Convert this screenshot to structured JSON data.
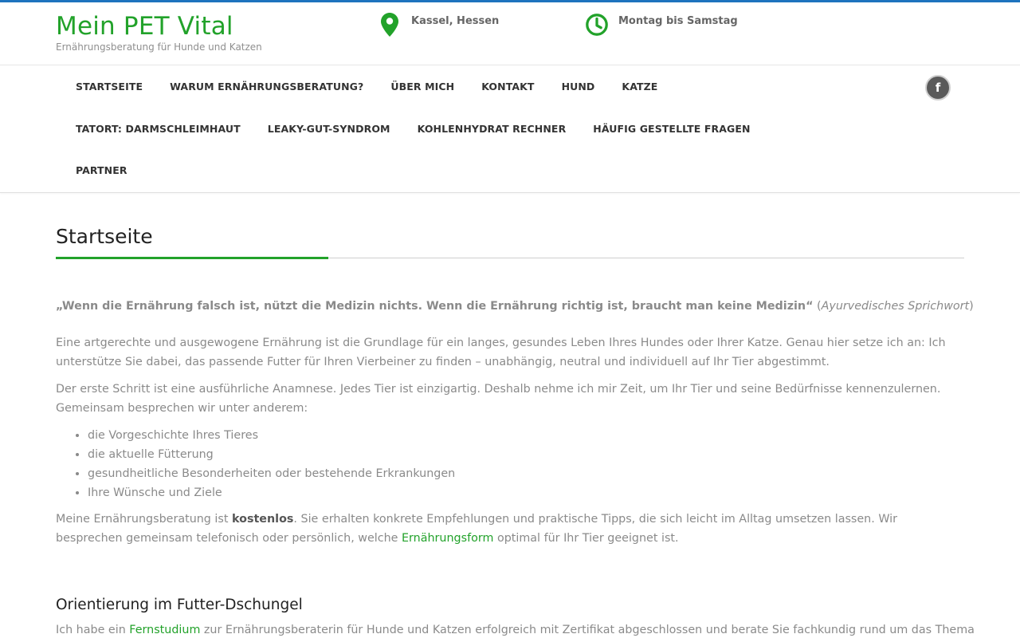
{
  "colors": {
    "accent": "#22a22a",
    "top_line": "#1e73be",
    "text": "#8a8a8a",
    "heading": "#222222"
  },
  "header": {
    "site_title": "Mein PET Vital",
    "site_description": "Ernährungsberatung für Hunde und Katzen",
    "location": {
      "icon": "map-marker-icon",
      "text": "Kassel, Hessen"
    },
    "hours": {
      "icon": "clock-icon",
      "text": "Montag bis Samstag"
    }
  },
  "nav": {
    "row1": [
      "STARTSEITE",
      "WARUM ERNÄHRUNGSBERATUNG?",
      "ÜBER MICH",
      "KONTAKT",
      "HUND",
      "KATZE"
    ],
    "row2": [
      "TATORT: DARMSCHLEIMHAUT",
      "LEAKY-GUT-SYNDROM",
      "KOHLENHYDRAT RECHNER",
      "HÄUFIG GESTELLTE FRAGEN"
    ],
    "row3": [
      "PARTNER"
    ],
    "social": {
      "icon": "facebook-icon",
      "glyph": "f"
    }
  },
  "content": {
    "page_title": "Startseite",
    "quote": {
      "text": "„Wenn die Ernährung falsch ist, nützt die Medizin nichts. Wenn die Ernährung richtig ist, braucht man keine Medizin“",
      "open_paren": " (",
      "source": "Ayurvedisches Sprichwort",
      "close_paren": ")"
    },
    "paragraph1": "Eine artgerechte und ausgewogene Ernährung ist die Grundlage für ein langes, gesundes Leben Ihres Hundes oder Ihrer Katze. Genau hier setze ich an: Ich unterstütze Sie dabei, das passende Futter für Ihren Vierbeiner zu finden – unabhängig, neutral und individuell auf Ihr Tier abgestimmt.",
    "paragraph2": "Der erste Schritt ist eine ausführliche Anamnese. Jedes Tier ist einzigartig. Deshalb nehme ich mir Zeit, um Ihr Tier und seine Bedürfnisse kennenzulernen. Gemeinsam besprechen wir unter anderem:",
    "list": [
      "die Vorgeschichte Ihres Tieres",
      "die aktuelle Fütterung",
      "gesundheitliche Besonderheiten oder bestehende Erkrankungen",
      "Ihre Wünsche und Ziele"
    ],
    "paragraph3": {
      "before": "Meine Ernährungsberatung ist ",
      "bold": "kostenlos",
      "middle": ". Sie erhalten konkrete Empfehlungen und praktische Tipps, die sich leicht im Alltag umsetzen lassen. Wir besprechen gemeinsam telefonisch oder persönlich, welche ",
      "link": "Ernährungsform",
      "after": " optimal für Ihr Tier geeignet ist."
    },
    "heading2": "Orientierung im Futter-Dschungel",
    "paragraph4": {
      "before": "Ich habe ein ",
      "link": "Fernstudium",
      "after": " zur Ernährungsberaterin für Hunde und Katzen erfolgreich mit Zertifikat abgeschlossen und berate Sie fachkundig rund um das Thema"
    }
  }
}
